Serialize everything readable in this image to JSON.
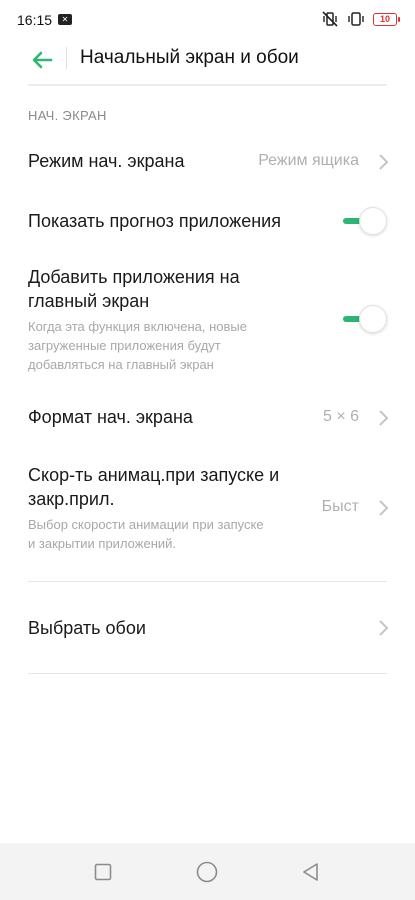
{
  "status_bar": {
    "time": "16:15",
    "notification_icon": "notification-icon",
    "battery_level": "10",
    "battery_color": "#dd3333"
  },
  "app_bar": {
    "title": "Начальный экран и обои",
    "back_icon": "back-arrow-icon",
    "accent_color": "#2bb673"
  },
  "section": {
    "header": "НАЧ. ЭКРАН"
  },
  "settings": {
    "home_mode": {
      "title": "Режим нач. экрана",
      "value": "Режим ящика"
    },
    "show_suggestions": {
      "title": "Показать прогноз приложения",
      "enabled": true
    },
    "add_apps": {
      "title_line1": "Добавить приложения на",
      "title_line2": "главный экран",
      "sub_line1": "Когда эта функция включена, новые",
      "sub_line2": "загруженные приложения будут",
      "sub_line3": "добавляться на главный экран",
      "enabled": true
    },
    "layout": {
      "title": "Формат нач. экрана",
      "value": "5 × 6"
    },
    "animation": {
      "title_line1": "Скор-ть анимац.при запуске и",
      "title_line2": "закр.прил.",
      "sub_line1": "Выбор скорости анимации при запуске",
      "sub_line2": "и закрытии приложений.",
      "value": "Быст"
    },
    "wallpaper": {
      "title": "Выбрать обои"
    }
  },
  "nav_bar": {
    "recents_icon": "square-recents-icon",
    "home_icon": "circle-home-icon",
    "back_icon": "triangle-back-icon"
  }
}
